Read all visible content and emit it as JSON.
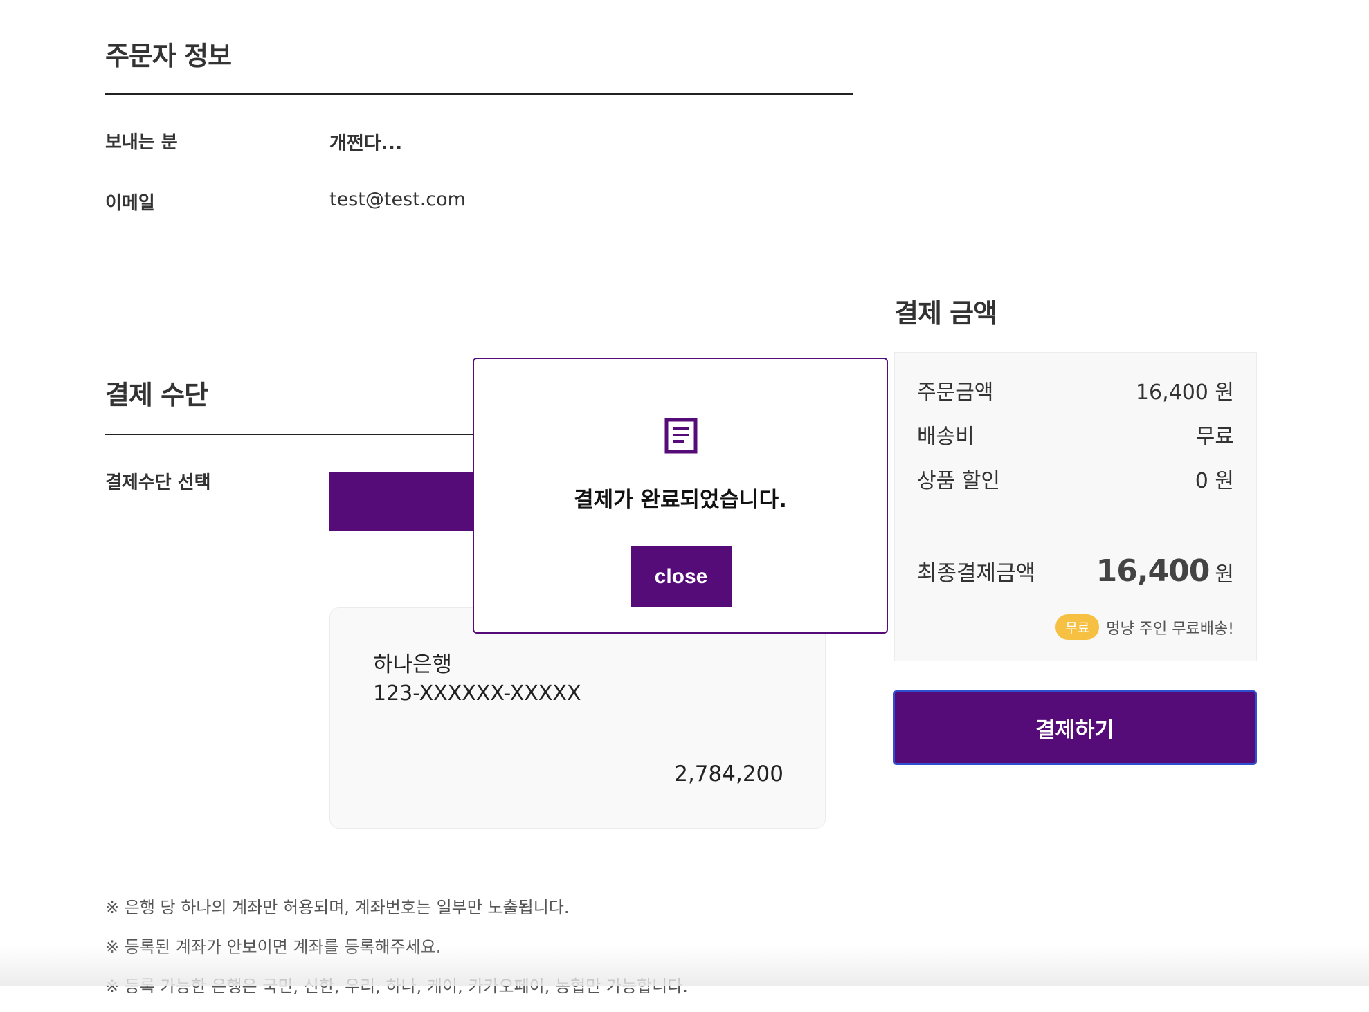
{
  "orderer": {
    "title": "주문자 정보",
    "sender_label": "보내는 분",
    "sender_value": "개쩐다...",
    "email_label": "이메일",
    "email_value": "test@test.com"
  },
  "payment_method": {
    "title": "결제 수단",
    "select_label": "결제수단 선택",
    "account": {
      "bank": "하나은행",
      "number": "123-XXXXXX-XXXXX",
      "balance": "2,784,200"
    },
    "notes": [
      "※ 은행 당 하나의 계좌만 허용되며, 계좌번호는 일부만 노출됩니다.",
      "※ 등록된 계좌가 안보이면 계좌를 등록해주세요.",
      "※ 등록 가능한 은행은 국민, 신한, 우리, 하나, 케이, 카카오페이, 농협만 가능합니다."
    ]
  },
  "summary": {
    "title": "결제 금액",
    "order_amount_label": "주문금액",
    "order_amount_value": "16,400 원",
    "shipping_label": "배송비",
    "shipping_value": "무료",
    "discount_label": "상품 할인",
    "discount_value": "0 원",
    "final_label": "최종결제금액",
    "final_amount": "16,400",
    "final_unit": "원",
    "free_badge": "무료",
    "free_text": "멍냥 주인 무료배송!",
    "pay_button": "결제하기"
  },
  "modal": {
    "icon": "document-icon",
    "message": "결제가 완료되었습니다.",
    "close_label": "close"
  },
  "colors": {
    "accent": "#560c78",
    "badge": "#f6c143",
    "focus_border": "#2f4fcf"
  }
}
